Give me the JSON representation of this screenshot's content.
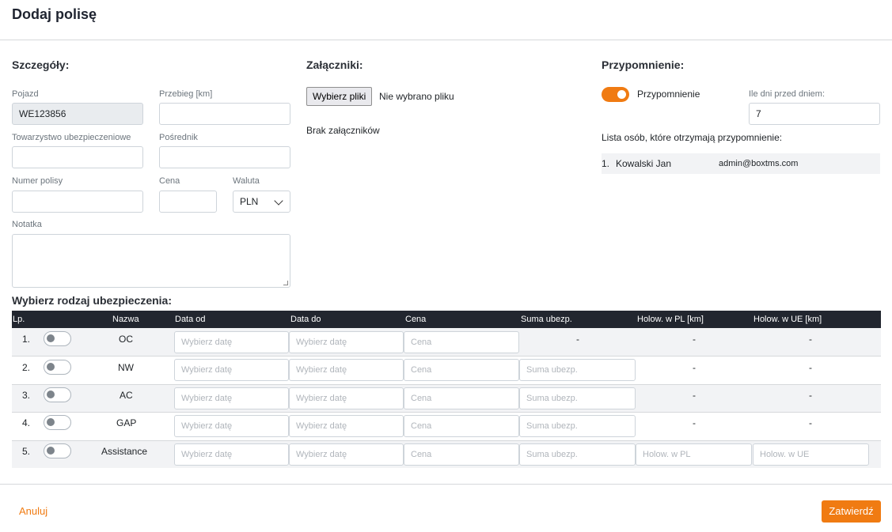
{
  "title": "Dodaj polisę",
  "details": {
    "section_title": "Szczegóły:",
    "vehicle_label": "Pojazd",
    "vehicle_value": "WE123856",
    "mileage_label": "Przebieg [km]",
    "insurer_label": "Towarzystwo ubezpieczeniowe",
    "broker_label": "Pośrednik",
    "policy_number_label": "Numer polisy",
    "price_label": "Cena",
    "currency_label": "Waluta",
    "currency_value": "PLN",
    "note_label": "Notatka"
  },
  "attachments": {
    "section_title": "Załączniki:",
    "choose_files_label": "Wybierz pliki",
    "no_file_text": "Nie wybrano pliku",
    "empty_text": "Brak załączników"
  },
  "reminder": {
    "section_title": "Przypomnienie:",
    "toggle_label": "Przypomnienie",
    "toggle_on": true,
    "days_label": "Ile dni przed dniem:",
    "days_value": "7",
    "recipients_label": "Lista osób, które otrzymają przypomnienie:",
    "recipients": [
      {
        "index": "1.",
        "name": "Kowalski Jan",
        "email": "admin@boxtms.com"
      }
    ]
  },
  "insurance": {
    "section_title": "Wybierz rodzaj ubezpieczenia:",
    "columns": [
      "Lp.",
      "Nazwa",
      "Data od",
      "Data do",
      "Cena",
      "Suma ubezp.",
      "Holow. w PL [km]",
      "Holow. w UE [km]"
    ],
    "placeholders": {
      "date": "Wybierz datę",
      "price": "Cena",
      "sum": "Suma ubezp.",
      "tow_pl": "Holow. w PL",
      "tow_ue": "Holow. w UE"
    },
    "dash": "-",
    "rows": [
      {
        "index": "1.",
        "name": "OC"
      },
      {
        "index": "2.",
        "name": "NW"
      },
      {
        "index": "3.",
        "name": "AC"
      },
      {
        "index": "4.",
        "name": "GAP"
      },
      {
        "index": "5.",
        "name": "Assistance"
      }
    ]
  },
  "footer": {
    "cancel_label": "Anuluj",
    "confirm_label": "Zatwierdź"
  },
  "colors": {
    "accent": "#f07b12",
    "table_header": "#22262f"
  }
}
